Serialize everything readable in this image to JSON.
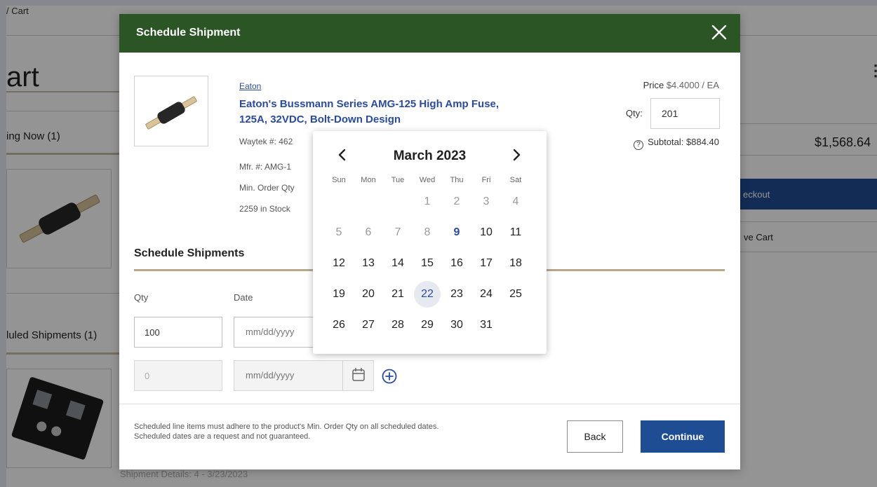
{
  "background": {
    "breadcrumb": "/ Cart",
    "page_title": "art",
    "shipping_now_label": "ing Now (1)",
    "scheduled_label": "luled Shipments (1)",
    "cart_total": "$1,568.64",
    "checkout_label": "eckout",
    "save_cart_label": "ve Cart",
    "shipment_details": "Shipment Details: 4 - 3/23/2023"
  },
  "modal": {
    "title": "Schedule Shipment",
    "product": {
      "brand": "Eaton",
      "name": "Eaton's Bussmann Series AMG-125 High Amp Fuse, 125A, 32VDC, Bolt-Down Design",
      "waytek_no": "Waytek #: 462",
      "mfr_no": "Mfr. #: AMG-1",
      "min_order": "Min. Order Qty",
      "stock": "2259 in Stock"
    },
    "pricing": {
      "price_label": "Price",
      "price_value": "$4.4000 / EA",
      "qty_label": "Qty:",
      "qty_value": "201",
      "subtotal": "Subtotal: $884.40"
    },
    "schedule": {
      "title": "Schedule Shipments",
      "qty_col": "Qty",
      "date_col": "Date",
      "rows": [
        {
          "qty": "100",
          "date_placeholder": "mm/dd/yyyy"
        },
        {
          "qty": "0",
          "date_placeholder": "mm/dd/yyyy"
        }
      ]
    },
    "footer_note_1": "Scheduled line items must adhere to the product's Min. Order Qty on all scheduled dates.",
    "footer_note_2": "Scheduled dates are a request and not guaranteed.",
    "back_label": "Back",
    "continue_label": "Continue"
  },
  "datepicker": {
    "month_label": "March 2023",
    "weekdays": [
      "Sun",
      "Mon",
      "Tue",
      "Wed",
      "Thu",
      "Fri",
      "Sat"
    ],
    "first_weekday_index": 3,
    "days_in_month": 31,
    "muted_through": 8,
    "today": 9,
    "selected": 22
  },
  "colors": {
    "header_green": "#2c5526",
    "primary_blue": "#1f4d94",
    "link_blue": "#2b4a9a",
    "rule_tan": "#b7a88d"
  }
}
